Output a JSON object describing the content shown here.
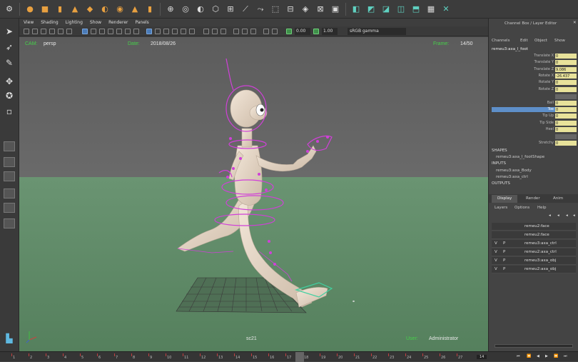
{
  "shelf": {
    "icons": [
      "sphere-icon",
      "cube-icon",
      "cylinder-icon",
      "cone-icon",
      "cube-alt-icon",
      "plane-icon",
      "torus-icon",
      "pipe-icon",
      "cylinder-icon",
      "tool-a-icon",
      "tool-b-icon",
      "tool-c-icon",
      "tool-d-icon",
      "tool-e-icon",
      "curve-icon",
      "tool-f-icon",
      "cube-icon",
      "mirror-icon",
      "tool-g-icon",
      "tool-h-icon",
      "tool-i-icon",
      "tool-j-icon",
      "tool-k-icon",
      "tool-l-icon",
      "tool-m-icon",
      "tool-n-icon"
    ]
  },
  "viewport": {
    "menu": [
      "View",
      "Shading",
      "Lighting",
      "Show",
      "Renderer",
      "Panels"
    ],
    "field_1": "0.00",
    "field_2": "1.00",
    "color_space": "sRGB gamma",
    "hud": {
      "cam_label": "CAM:",
      "cam_value": "persp",
      "date_label": "Date:",
      "date_value": "2018/08/26",
      "frame_label": "Frame:",
      "frame_value": "14/50",
      "scene_name": "sc21",
      "user_label": "User:",
      "user_value": "Administrator"
    }
  },
  "channel_box": {
    "title": "Channel Box / Layer Editor",
    "menu": [
      "Channels",
      "Edit",
      "Object",
      "Show"
    ],
    "node": "remeu3:axa_l_foot",
    "rows": [
      {
        "label": "Translate X",
        "value": "0"
      },
      {
        "label": "Translate Y",
        "value": "0"
      },
      {
        "label": "Translate Z",
        "value": "9.086"
      },
      {
        "label": "Rotate X",
        "value": "-26.437"
      },
      {
        "label": "Rotate Y",
        "value": "0"
      },
      {
        "label": "Rotate Z",
        "value": "0"
      },
      {
        "label": "",
        "value": ""
      },
      {
        "label": "Ball",
        "value": "0"
      },
      {
        "label": "Toe",
        "value": "0"
      },
      {
        "label": "Tip Up",
        "value": "0"
      },
      {
        "label": "Tip Side",
        "value": "0"
      },
      {
        "label": "Heel",
        "value": "0"
      },
      {
        "label": "",
        "value": ""
      },
      {
        "label": "Stretchy",
        "value": "0"
      }
    ],
    "shapes_label": "SHAPES",
    "shape": "remeu3:axa_l_footShape",
    "inputs_label": "INPUTS",
    "inputs": [
      "remeu3:axa_Body",
      "remeu3:axa_ctrl"
    ],
    "outputs_label": "OUTPUTS"
  },
  "layers": {
    "tabs": [
      "Display",
      "Render",
      "Anim"
    ],
    "menu": [
      "Layers",
      "Options",
      "Help"
    ],
    "rows": [
      {
        "v": "",
        "p": "",
        "name": "remeu2:face"
      },
      {
        "v": "",
        "p": "",
        "name": "remeu2:face"
      },
      {
        "v": "V",
        "p": "P",
        "name": "remeu3:axa_ctrl"
      },
      {
        "v": "V",
        "p": "P",
        "name": "remeu2:axa_ctrl"
      },
      {
        "v": "V",
        "p": "P",
        "name": "remeu3:axa_obj"
      },
      {
        "v": "V",
        "p": "P",
        "name": "remeu2:axa_obj"
      }
    ]
  },
  "timeline": {
    "ticks": [
      "1",
      "2",
      "3",
      "4",
      "5",
      "6",
      "7",
      "8",
      "9",
      "10",
      "11",
      "12",
      "13",
      "14",
      "15",
      "16",
      "17",
      "18",
      "19",
      "20",
      "21",
      "22",
      "23",
      "24",
      "25",
      "26",
      "27"
    ],
    "current_frame": "14"
  },
  "colors": {
    "accent": "#4a7bb8",
    "hud_green": "#46d04a",
    "ground": "#5f8a68",
    "control_magenta": "#d040d8"
  }
}
